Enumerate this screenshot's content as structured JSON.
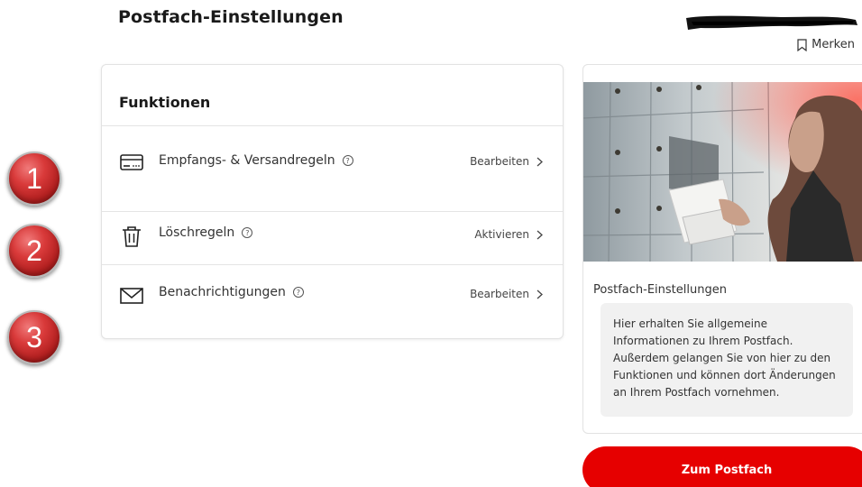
{
  "page": {
    "title": "Postfach-Einstellungen"
  },
  "header": {
    "bookmark_label": "Merken"
  },
  "badges": [
    "1",
    "2",
    "3"
  ],
  "functions": {
    "heading": "Funktionen",
    "items": [
      {
        "label": "Empfangs- & Versandregeln",
        "action": "Bearbeiten",
        "icon": "card-icon"
      },
      {
        "label": "Löschregeln",
        "action": "Aktivieren",
        "icon": "trash-icon"
      },
      {
        "label": "Benachrichtigungen",
        "action": "Bearbeiten",
        "icon": "envelope-icon"
      }
    ],
    "help_glyph": "?"
  },
  "info_card": {
    "title": "Postfach-Einstellungen",
    "text": "Hier erhalten Sie allgemeine Informationen zu Ihrem Postfach. Außerdem gelangen Sie von hier zu den Funktionen und können dort Änderungen an Ihrem Postfach vornehmen."
  },
  "cta": {
    "label": "Zum Postfach"
  },
  "colors": {
    "accent": "#e60000",
    "badge": "#c62828",
    "info_bg": "#f1f1f1"
  }
}
